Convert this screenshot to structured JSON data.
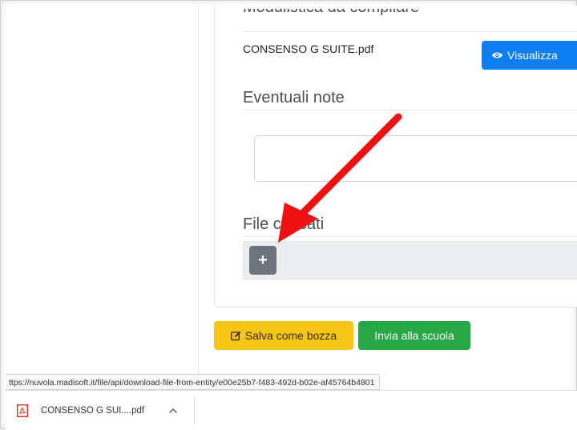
{
  "form": {
    "section_heading": "Modulistica da compilare",
    "attachment_name": "CONSENSO G SUITE.pdf",
    "view_button_label": "Visualizza",
    "notes_title": "Eventuali note",
    "notes_value": "",
    "files_title": "File caricati",
    "add_button_symbol": "+"
  },
  "actions": {
    "save_draft_label": "Salva come bozza",
    "send_label": "Invia alla scuola",
    "colors": {
      "save_draft": "#f5c518",
      "send": "#28a745",
      "view": "#0d7ff3"
    }
  },
  "browser": {
    "status_url": "ttps://nuvola.madisoft.it/file/api/download-file-from-entity/e00e25b7-f483-492d-b02e-af45764b4801",
    "download_item_name": "CONSENSO G SUI....pdf"
  },
  "annotation": {
    "arrow_color": "#ee1111"
  },
  "icons": [
    "eye-icon",
    "edit-icon",
    "plus-icon",
    "pdf-file-icon",
    "chevron-up-icon",
    "red-arrow"
  ]
}
